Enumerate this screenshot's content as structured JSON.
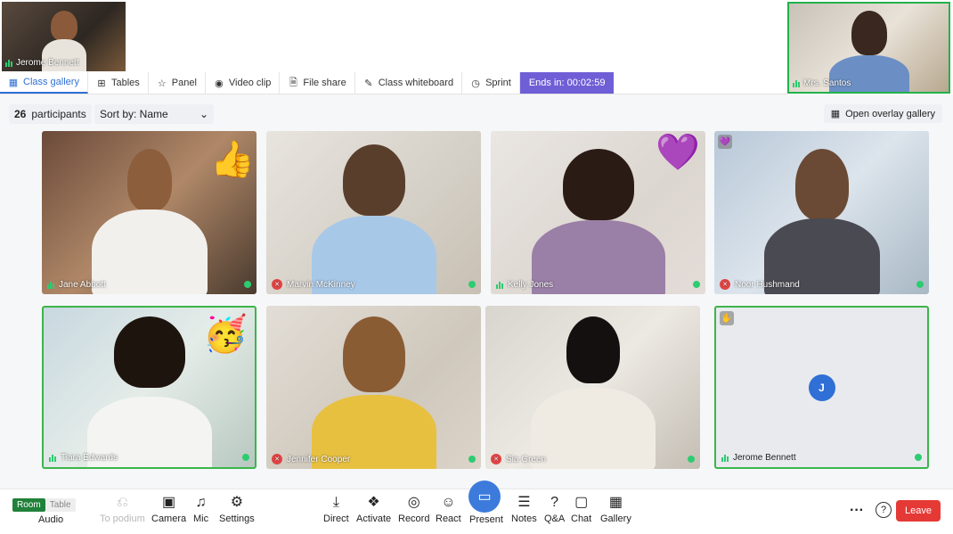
{
  "self_view": {
    "name": "Jerome Bennett"
  },
  "teacher_view": {
    "name": "Mrs. Santos"
  },
  "tabs": [
    {
      "label": "Class gallery",
      "icon": "grid-icon",
      "glyph": "▦"
    },
    {
      "label": "Tables",
      "icon": "tables-icon",
      "glyph": "⊞"
    },
    {
      "label": "Panel",
      "icon": "star-icon",
      "glyph": "☆"
    },
    {
      "label": "Video clip",
      "icon": "play-circle-icon",
      "glyph": "◉"
    },
    {
      "label": "File share",
      "icon": "file-icon",
      "glyph": "🗎"
    },
    {
      "label": "Class whiteboard",
      "icon": "whiteboard-icon",
      "glyph": "✎"
    },
    {
      "label": "Sprint",
      "icon": "timer-icon",
      "glyph": "◷"
    }
  ],
  "timer": {
    "label": "Ends in:",
    "value": "00:02:59"
  },
  "gallery": {
    "count": "26",
    "count_label": "participants",
    "sort_label": "Sort by: Name",
    "overlay_label": "Open overlay gallery"
  },
  "participants": [
    {
      "name": "Jane Abbott",
      "mic": "on",
      "emoji": "👍"
    },
    {
      "name": "Marvin McKinney",
      "mic": "muted"
    },
    {
      "name": "Kelly Jones",
      "mic": "on",
      "emoji": "💜"
    },
    {
      "name": "Noor Hushmand",
      "mic": "muted",
      "badge": "💜"
    },
    {
      "name": "Tiara Edwards",
      "mic": "on",
      "emoji": "🥳"
    },
    {
      "name": "Jennifer Cooper",
      "mic": "muted"
    },
    {
      "name": "Sia Green",
      "mic": "muted"
    },
    {
      "name": "Jerome Bennett",
      "mic": "on",
      "badge": "✋",
      "avatar": "J"
    }
  ],
  "toolbar": {
    "room": "Room",
    "table": "Table",
    "audio": "Audio",
    "to_podium": "To podium",
    "camera": "Camera",
    "mic": "Mic",
    "settings": "Settings",
    "direct": "Direct",
    "activate": "Activate",
    "record": "Record",
    "react": "React",
    "present": "Present",
    "notes": "Notes",
    "qa": "Q&A",
    "chat": "Chat",
    "gallery": "Gallery",
    "leave": "Leave"
  },
  "colors": {
    "accent": "#2f6fd6",
    "timer": "#6f5fd6",
    "highlight": "#3bb54a",
    "leave": "#e53935"
  }
}
